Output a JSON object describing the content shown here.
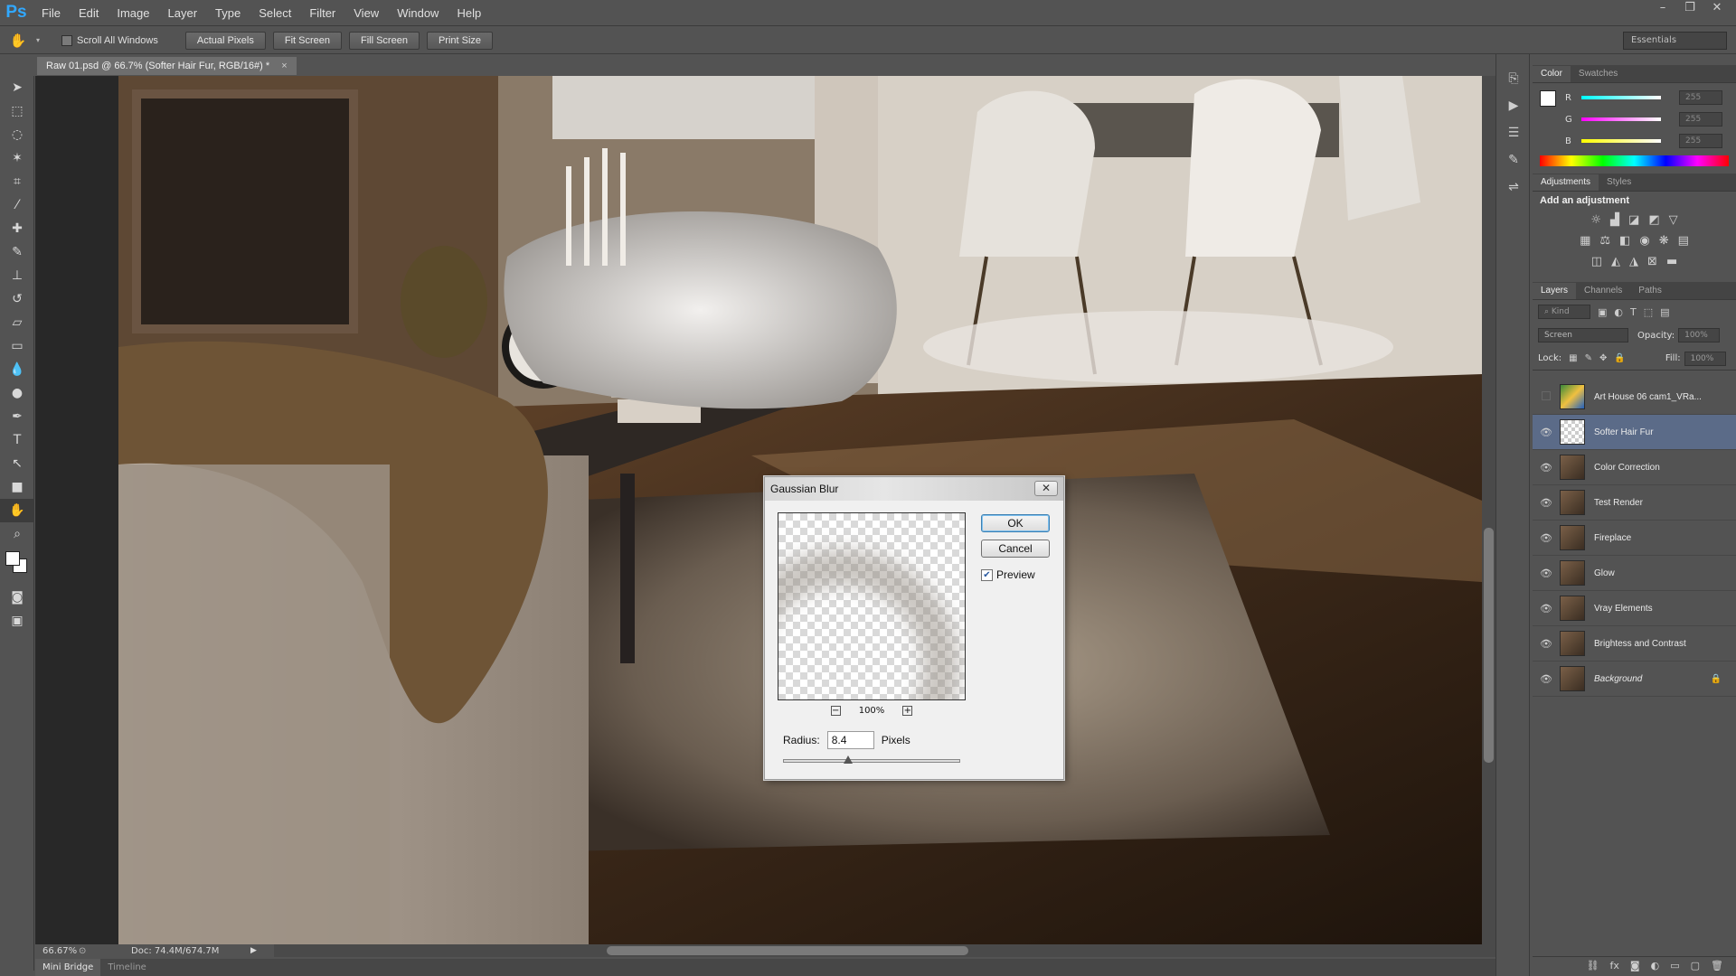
{
  "app": {
    "logo": "Ps",
    "menu": [
      "File",
      "Edit",
      "Image",
      "Layer",
      "Type",
      "Select",
      "Filter",
      "View",
      "Window",
      "Help"
    ],
    "window_controls": [
      "–",
      "❐",
      "✕"
    ]
  },
  "options_bar": {
    "scroll_all_windows": "Scroll All Windows",
    "buttons": [
      "Actual Pixels",
      "Fit Screen",
      "Fill Screen",
      "Print Size"
    ],
    "workspace": "Essentials"
  },
  "document": {
    "tab_title": "Raw 01.psd @ 66.7% (Softer Hair Fur, RGB/16#) *",
    "close": "×"
  },
  "status": {
    "zoom": "66.67%",
    "doc_size": "Doc: 74.4M/674.7M"
  },
  "bottom_tabs": [
    "Mini Bridge",
    "Timeline"
  ],
  "color_panel": {
    "tabs": [
      "Color",
      "Swatches"
    ],
    "channels": [
      {
        "label": "R",
        "value": "255",
        "gradient": "#00ffff"
      },
      {
        "label": "G",
        "value": "255",
        "gradient": "#ff00ff"
      },
      {
        "label": "B",
        "value": "255",
        "gradient": "#ffff00"
      }
    ]
  },
  "adjustments_panel": {
    "tabs": [
      "Adjustments",
      "Styles"
    ],
    "heading": "Add an adjustment"
  },
  "layers_panel": {
    "tabs": [
      "Layers",
      "Channels",
      "Paths"
    ],
    "kind": "Kind",
    "blend_mode": "Screen",
    "opacity_label": "Opacity:",
    "opacity_value": "100%",
    "lock_label": "Lock:",
    "fill_label": "Fill:",
    "fill_value": "100%",
    "layers": [
      {
        "name": "Art House 06 cam1_VRa...",
        "visible": false,
        "thumb": "art"
      },
      {
        "name": "Softer Hair Fur",
        "visible": true,
        "thumb": "checker",
        "selected": true
      },
      {
        "name": "Color Correction",
        "visible": true,
        "thumb": "photo"
      },
      {
        "name": "Test Render",
        "visible": true,
        "thumb": "photo"
      },
      {
        "name": "Fireplace",
        "visible": true,
        "thumb": "photo"
      },
      {
        "name": "Glow",
        "visible": true,
        "thumb": "photo"
      },
      {
        "name": "Vray Elements",
        "visible": true,
        "thumb": "photo"
      },
      {
        "name": "Brightess and Contrast",
        "visible": true,
        "thumb": "photo"
      },
      {
        "name": "Background",
        "visible": true,
        "thumb": "photo",
        "locked": true
      }
    ]
  },
  "gaussian_blur": {
    "title": "Gaussian Blur",
    "ok": "OK",
    "cancel": "Cancel",
    "preview_label": "Preview",
    "preview_checked": true,
    "zoom": "100%",
    "radius_label": "Radius:",
    "radius_value": "8.4",
    "radius_units": "Pixels"
  },
  "colors": {
    "accent": "#31a8ff",
    "selected_layer": "#5b6b88"
  }
}
